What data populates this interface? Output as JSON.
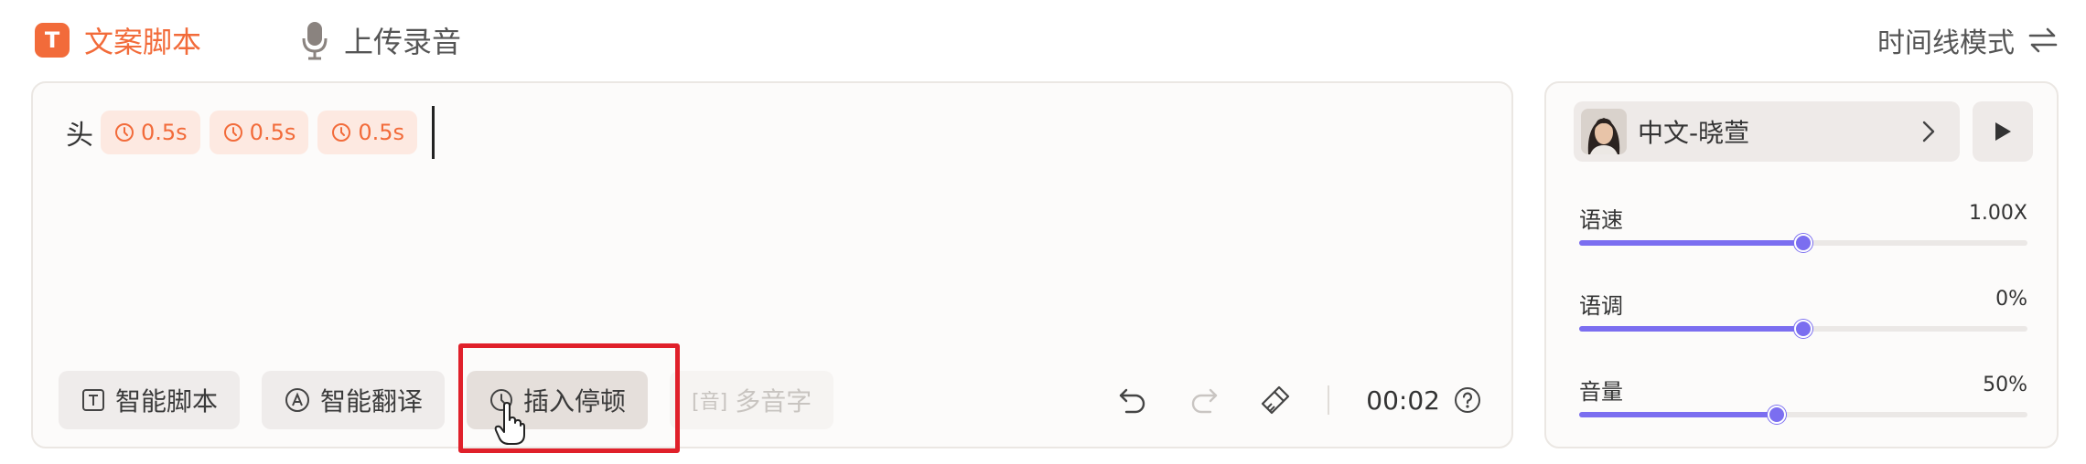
{
  "tabs": {
    "script": {
      "badge": "T",
      "label": "文案脚本"
    },
    "upload": {
      "label": "上传录音"
    }
  },
  "mode_switch": {
    "label": "时间线模式"
  },
  "editor": {
    "text": "头",
    "pauses": [
      "0.5s",
      "0.5s",
      "0.5s"
    ]
  },
  "toolbar": {
    "smart_script": "智能脚本",
    "smart_translate": "智能翻译",
    "insert_pause": "插入停顿",
    "polyphone": "多音字",
    "polyphone_icon_char": "[音]",
    "duration": "00:02"
  },
  "voice": {
    "name": "中文-晓萱",
    "speed": {
      "label": "语速",
      "value": "1.00X",
      "level": 0.5
    },
    "pitch": {
      "label": "语调",
      "value": "0%",
      "level": 0.5
    },
    "volume": {
      "label": "音量",
      "value": "50%",
      "level": 0.44
    }
  },
  "colors": {
    "accent": "#f26b3a",
    "slider": "#7b6ef0",
    "highlight": "#e0202a"
  }
}
